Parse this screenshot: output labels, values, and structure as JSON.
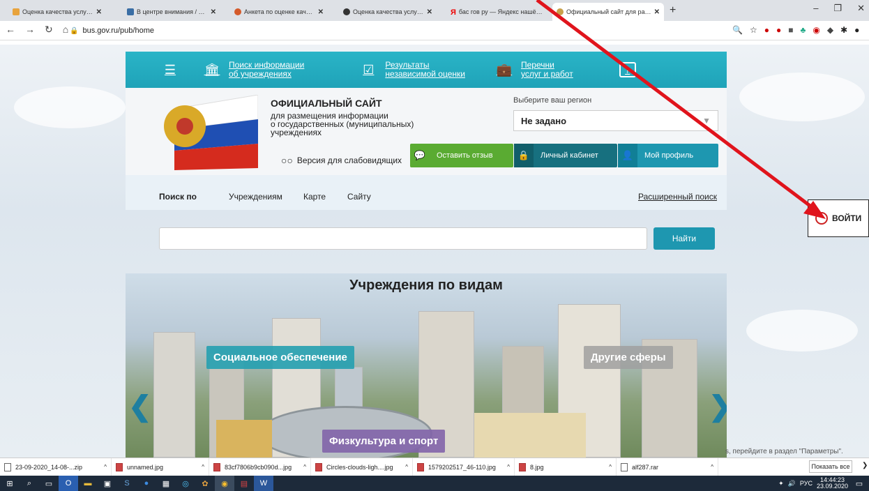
{
  "browser": {
    "tabs": [
      {
        "label": "Оценка качества услуг - Оценк"
      },
      {
        "label": "В центре внимания / Министер"
      },
      {
        "label": "Анкета по оценке качества усл"
      },
      {
        "label": "Оценка качества услуг учрежд"
      },
      {
        "label": "бас гов ру — Яндекс нашёлся"
      },
      {
        "label": "Официальный сайт для размещ"
      }
    ],
    "url": "bus.gov.ru/pub/home"
  },
  "nav": {
    "item1": "Поиск информации об учреждениях",
    "item1a": "Поиск информации",
    "item1b": "об учреждениях",
    "item2a": "Результаты",
    "item2b": "независимой оценки",
    "item3a": "Перечни",
    "item3b": "услуг и работ"
  },
  "header": {
    "title": "ОФИЦИАЛЬНЫЙ САЙТ",
    "sub1": "для размещения информации",
    "sub2": "о государственных (муниципальных)",
    "sub3": "учреждениях",
    "low_vision": "Версия для слабовидящих",
    "region_label": "Выберите ваш регион",
    "region_value": "Не задано",
    "feedback": "Оставить отзыв",
    "cabinet": "Личный кабинет",
    "profile": "Мой профиль"
  },
  "search": {
    "by": "Поиск по",
    "opt1": "Учреждениям",
    "opt2": "Карте",
    "opt3": "Сайту",
    "advanced": "Расширенный поиск",
    "find": "Найти"
  },
  "gallery": {
    "title": "Учреждения по видам",
    "cat1": "Социальное обеспечение",
    "cat2": "Другие сферы",
    "cat3": "Физкультура и спорт"
  },
  "login": {
    "label": "ВОЙТИ"
  },
  "params_hint": "s, перейдите в раздел \"Параметры\".",
  "downloads": [
    {
      "name": "23-09-2020_14-08-...zip",
      "img": false
    },
    {
      "name": "unnamed.jpg",
      "img": true
    },
    {
      "name": "83cf7806b9cb090d...jpg",
      "img": true
    },
    {
      "name": "Circles-clouds-ligh....jpg",
      "img": true
    },
    {
      "name": "1579202517_46-110.jpg",
      "img": true
    },
    {
      "name": "8.jpg",
      "img": true
    },
    {
      "name": "alf287.rar",
      "img": false
    }
  ],
  "show_all": "Показать все",
  "taskbar": {
    "lang": "РУС",
    "time": "14:44:23",
    "date": "23.09.2020"
  },
  "colors": {
    "accent": "#1fa3b8",
    "green": "#5aab32",
    "dark_teal": "#17707f",
    "arrow": "#e0141c"
  }
}
